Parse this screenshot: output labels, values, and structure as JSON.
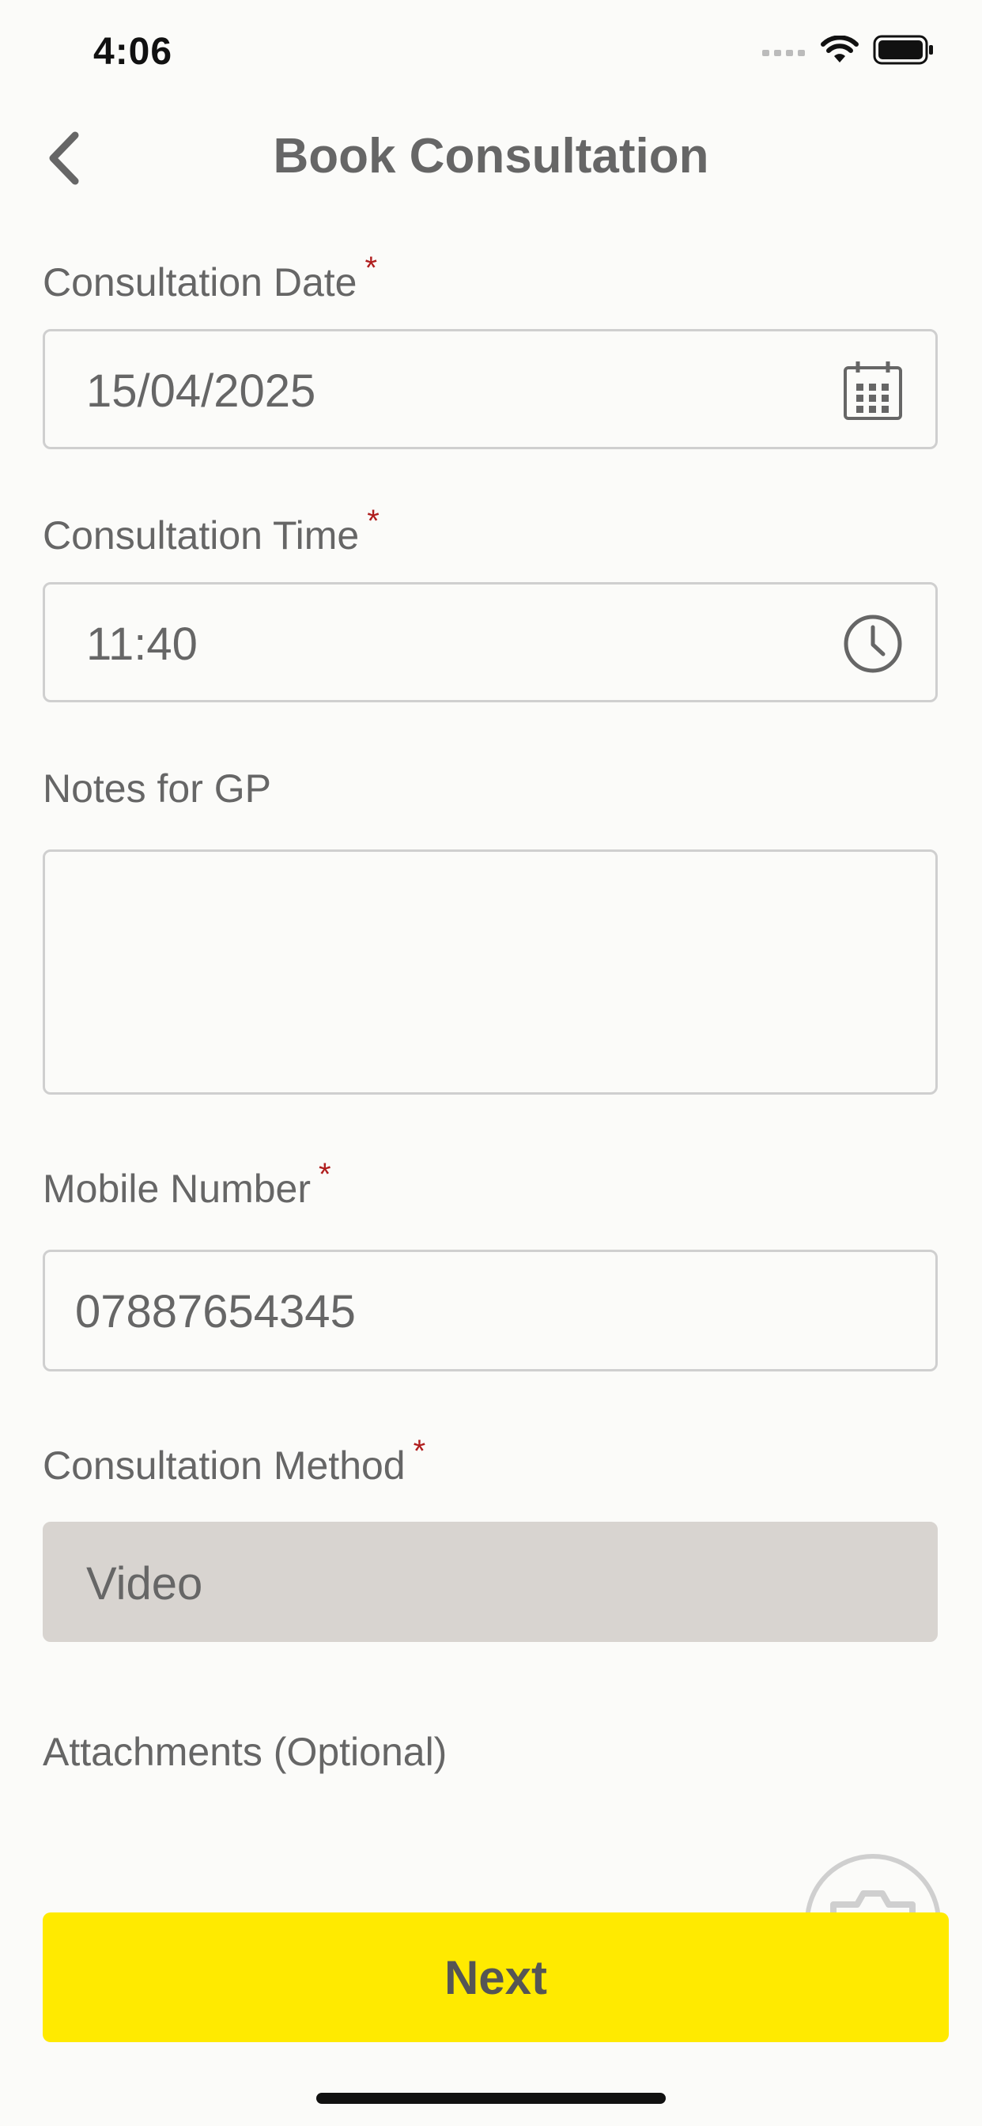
{
  "status_bar": {
    "time": "4:06"
  },
  "nav": {
    "title": "Book Consultation"
  },
  "form": {
    "date": {
      "label": "Consultation Date",
      "required": "*",
      "value": "15/04/2025"
    },
    "time": {
      "label": "Consultation Time",
      "required": "*",
      "value": "11:40"
    },
    "notes": {
      "label": "Notes for GP",
      "value": ""
    },
    "mobile": {
      "label": "Mobile Number",
      "required": "*",
      "value": "07887654345"
    },
    "method": {
      "label": "Consultation Method",
      "required": "*",
      "value": "Video"
    },
    "attachments": {
      "label": "Attachments (Optional)"
    }
  },
  "actions": {
    "next_label": "Next"
  },
  "colors": {
    "accent": "#ffea00",
    "required": "#b01e1e",
    "disabled_field": "#d8d4d0"
  },
  "icons": [
    "chevron-left-icon",
    "calendar-icon",
    "clock-icon",
    "camera-icon",
    "signal-icon",
    "wifi-icon",
    "battery-icon"
  ]
}
